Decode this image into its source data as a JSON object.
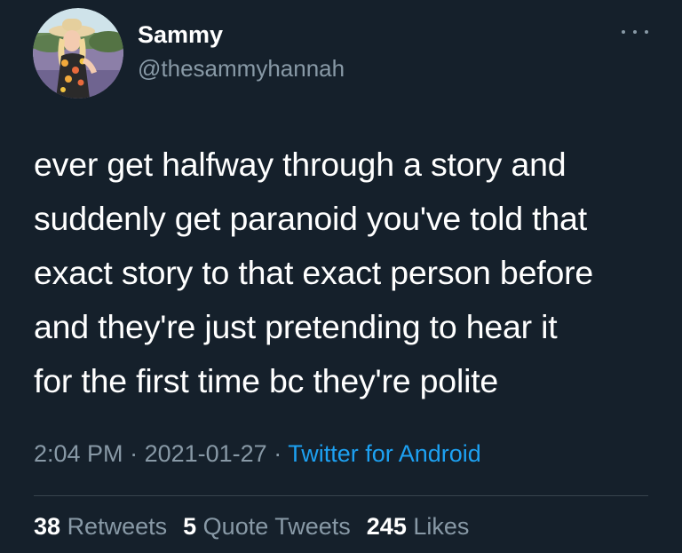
{
  "colors": {
    "background": "#15202b",
    "primary_text": "#ffffff",
    "secondary_text": "#8899a6",
    "link": "#1da1f2",
    "divider": "#38444d"
  },
  "author": {
    "name": "Sammy",
    "handle": "@thesammyhannah",
    "avatar_icon": "profile-photo-avatar"
  },
  "more_icon": "ellipsis-icon",
  "tweet": {
    "lines": [
      "ever get halfway through a story and",
      "suddenly get paranoid you've told that",
      "exact story to that exact person before",
      "and they're just pretending to hear it",
      "for the first time bc they're polite"
    ]
  },
  "meta": {
    "time": "2:04 PM",
    "sep1": " · ",
    "date": "2021-01-27",
    "sep2": " · ",
    "source": "Twitter for Android"
  },
  "stats": {
    "retweets": {
      "count": "38",
      "label": "Retweets"
    },
    "quote_tweets": {
      "count": "5",
      "label": "Quote Tweets"
    },
    "likes": {
      "count": "245",
      "label": "Likes"
    }
  }
}
